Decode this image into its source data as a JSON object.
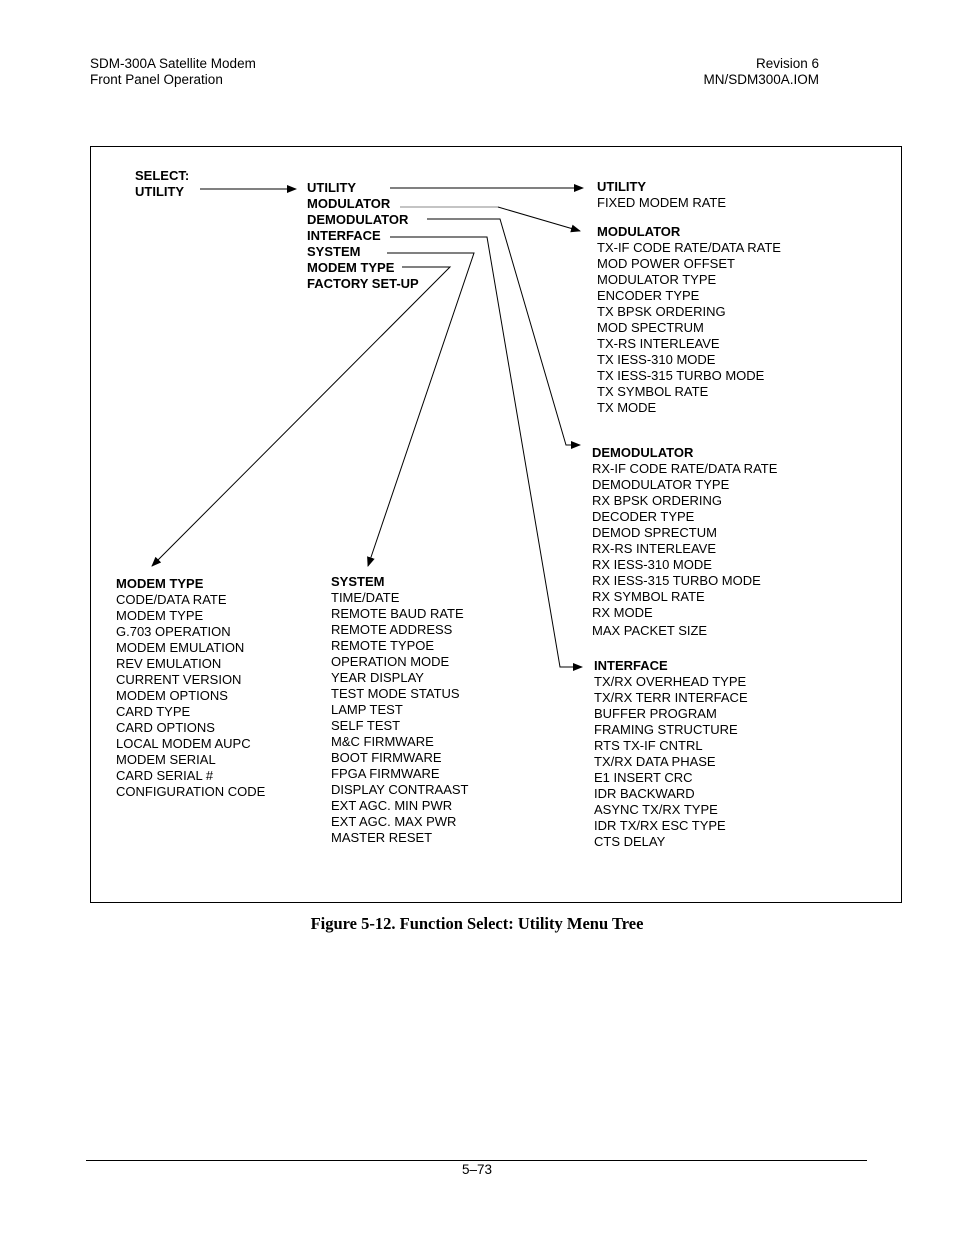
{
  "header": {
    "left_line1": "SDM-300A Satellite Modem",
    "left_line2": "Front Panel Operation",
    "right_line1": "Revision 6",
    "right_line2": "MN/SDM300A.IOM"
  },
  "diagram": {
    "root": {
      "line1": "SELECT:",
      "line2": "UTILITY"
    },
    "menu": [
      "UTILITY",
      "MODULATOR",
      "DEMODULATOR",
      "INTERFACE",
      "SYSTEM",
      "MODEM TYPE",
      "FACTORY SET-UP"
    ],
    "utility": {
      "title": "UTILITY",
      "items": [
        "FIXED MODEM RATE"
      ]
    },
    "modulator": {
      "title": "MODULATOR",
      "items": [
        "TX-IF CODE RATE/DATA RATE",
        "MOD POWER OFFSET",
        "MODULATOR TYPE",
        "ENCODER TYPE",
        "TX BPSK ORDERING",
        "MOD SPECTRUM",
        "TX-RS INTERLEAVE",
        "TX IESS-310 MODE",
        "TX IESS-315 TURBO MODE",
        "TX SYMBOL RATE",
        "TX MODE"
      ]
    },
    "demodulator": {
      "title": "DEMODULATOR",
      "items": [
        "RX-IF CODE RATE/DATA RATE",
        "DEMODULATOR TYPE",
        "RX BPSK ORDERING",
        "DECODER TYPE",
        "DEMOD SPRECTUM",
        "RX-RS INTERLEAVE",
        "RX IESS-310 MODE",
        "RX IESS-315 TURBO MODE",
        "RX SYMBOL RATE",
        "RX MODE",
        "MAX PACKET SIZE"
      ]
    },
    "interface": {
      "title": "INTERFACE",
      "items": [
        "TX/RX OVERHEAD TYPE",
        "TX/RX TERR INTERFACE",
        "BUFFER PROGRAM",
        "FRAMING STRUCTURE",
        "RTS TX-IF CNTRL",
        "TX/RX DATA PHASE",
        "E1 INSERT CRC",
        "IDR BACKWARD",
        "ASYNC TX/RX TYPE",
        "IDR TX/RX ESC TYPE",
        "CTS DELAY"
      ]
    },
    "modem_type": {
      "title": "MODEM TYPE",
      "items": [
        "CODE/DATA RATE",
        "MODEM TYPE",
        "G.703 OPERATION",
        "MODEM EMULATION",
        "REV EMULATION",
        "CURRENT VERSION",
        "MODEM OPTIONS",
        "CARD TYPE",
        "CARD OPTIONS",
        "LOCAL MODEM AUPC",
        "MODEM SERIAL",
        "CARD SERIAL #",
        "CONFIGURATION CODE"
      ]
    },
    "system": {
      "title": "SYSTEM",
      "items": [
        "TIME/DATE",
        "REMOTE BAUD RATE",
        "REMOTE ADDRESS",
        "REMOTE TYPOE",
        "OPERATION MODE",
        "YEAR DISPLAY",
        "TEST MODE STATUS",
        "LAMP TEST",
        "SELF TEST",
        "M&C FIRMWARE",
        "BOOT FIRMWARE",
        "FPGA FIRMWARE",
        "DISPLAY CONTRAAST",
        "EXT AGC. MIN PWR",
        "EXT AGC. MAX PWR",
        "MASTER RESET"
      ]
    }
  },
  "caption": "Figure 5-12. Function Select: Utility Menu Tree",
  "footer": {
    "page_number": "5–73"
  }
}
